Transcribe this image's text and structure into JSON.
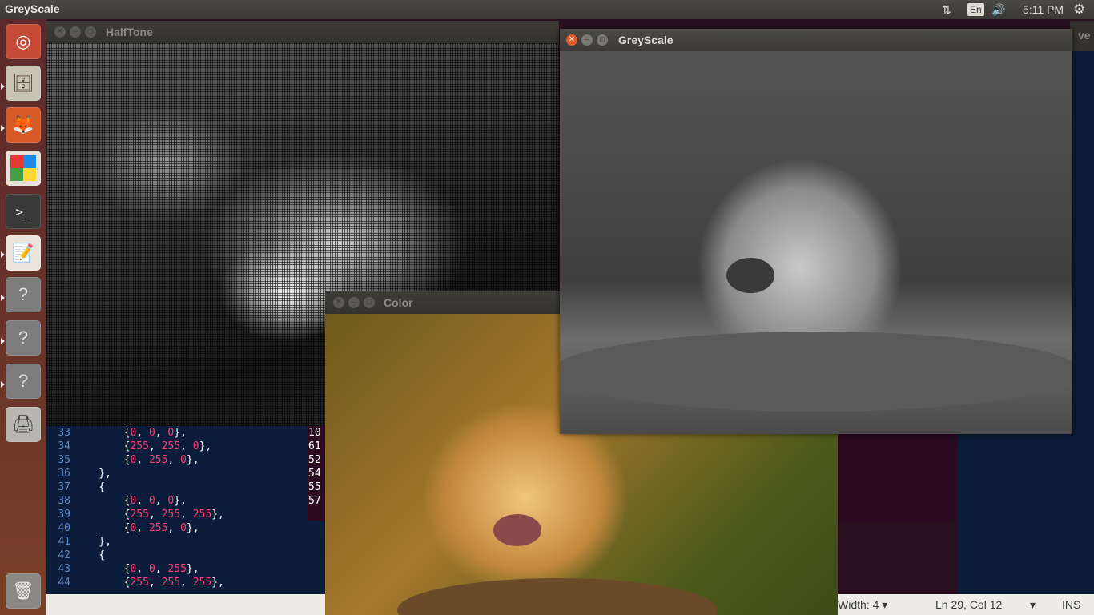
{
  "topbar": {
    "app_title": "GreyScale",
    "network_icon": "network-updown-icon",
    "lang": "En",
    "volume_icon": "volume-icon",
    "clock": "5:11 PM",
    "gear_icon": "gear-icon"
  },
  "launcher": {
    "items": [
      "ubuntu-logo-icon",
      "files-icon",
      "firefox-icon",
      "software-center-icon",
      "terminal-icon",
      "text-editor-icon",
      "unknown-app-icon",
      "unknown-app-icon",
      "unknown-app-icon",
      "scanner-icon",
      "trash-icon"
    ]
  },
  "windows": {
    "halftone": {
      "title": "HalfTone"
    },
    "greyscale": {
      "title": "GreyScale"
    },
    "color": {
      "title": "Color"
    },
    "behind_partial": "ve"
  },
  "editor": {
    "lines": [
      {
        "n": "33",
        "text": "        {",
        "nums": [
          "0",
          "0",
          "0"
        ],
        "close": "},"
      },
      {
        "n": "34",
        "text": "        {",
        "nums": [
          "255",
          "255",
          "0"
        ],
        "close": "},"
      },
      {
        "n": "35",
        "text": "        {",
        "nums": [
          "0",
          "255",
          "0"
        ],
        "close": "},"
      },
      {
        "n": "36",
        "plain": "    },"
      },
      {
        "n": "37",
        "plain": "    {"
      },
      {
        "n": "38",
        "text": "        {",
        "nums": [
          "0",
          "0",
          "0"
        ],
        "close": "},"
      },
      {
        "n": "39",
        "text": "        {",
        "nums": [
          "255",
          "255",
          "255"
        ],
        "close": "},"
      },
      {
        "n": "40",
        "text": "        {",
        "nums": [
          "0",
          "255",
          "0"
        ],
        "close": "},"
      },
      {
        "n": "41",
        "plain": "    },"
      },
      {
        "n": "42",
        "plain": "    {"
      },
      {
        "n": "43",
        "text": "        {",
        "nums": [
          "0",
          "0",
          "255"
        ],
        "close": "},"
      },
      {
        "n": "44",
        "text": "        {",
        "nums": [
          "255",
          "255",
          "255"
        ],
        "close": "},"
      }
    ],
    "side_values": [
      "10",
      "61",
      "52",
      "54",
      "55",
      "57"
    ]
  },
  "statusbar": {
    "tab_width": "Width: 4",
    "position": "Ln 29, Col 12",
    "mode": "INS"
  },
  "colors": {
    "editor_bg": "#0b1d3a",
    "number": "#ff3d71",
    "accent_close": "#e05a2b"
  }
}
